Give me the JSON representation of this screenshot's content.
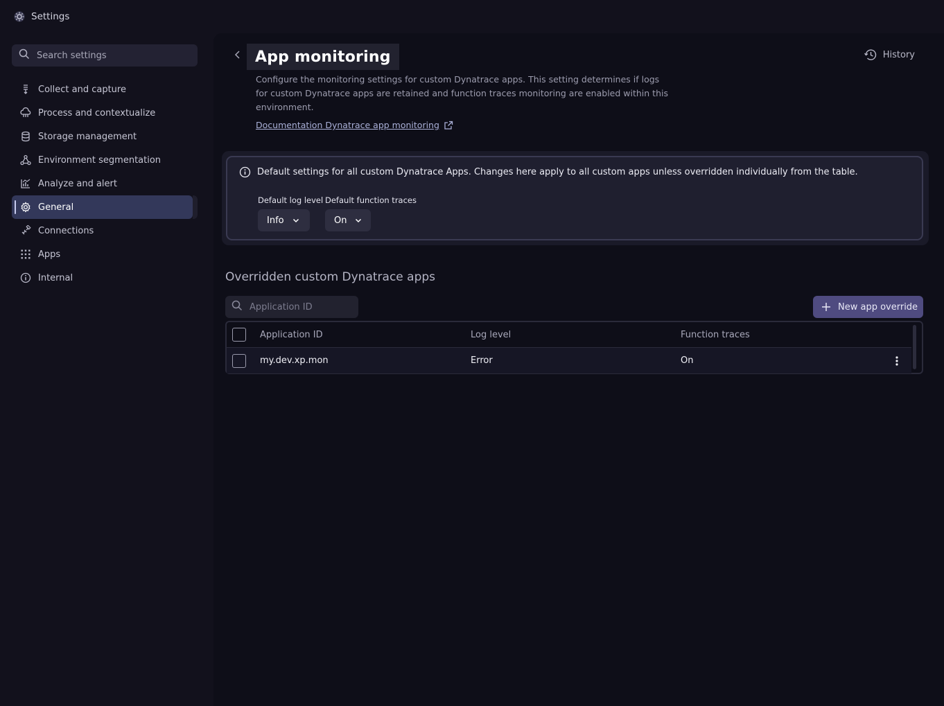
{
  "window": {
    "title": "Settings",
    "app_icon": "gear-icon"
  },
  "sidebar": {
    "search_placeholder": "Search settings",
    "items": [
      {
        "label": "Collect and capture",
        "icon": "collect-icon"
      },
      {
        "label": "Process and contextualize",
        "icon": "process-icon"
      },
      {
        "label": "Storage management",
        "icon": "database-icon"
      },
      {
        "label": "Environment segmentation",
        "icon": "segmentation-icon"
      },
      {
        "label": "Analyze and alert",
        "icon": "chart-icon"
      },
      {
        "label": "General",
        "icon": "gear-icon",
        "active": true
      },
      {
        "label": "Connections",
        "icon": "connections-icon"
      },
      {
        "label": "Apps",
        "icon": "apps-grid-icon"
      },
      {
        "label": "Internal",
        "icon": "info-icon"
      }
    ]
  },
  "header": {
    "title": "App monitoring",
    "history_label": "History",
    "description": "Configure the monitoring settings for custom Dynatrace apps. This setting determines if logs for custom Dynatrace apps are retained and function traces monitoring are enabled within this environment.",
    "doc_link": "Documentation Dynatrace app monitoring"
  },
  "defaults": {
    "info": "Default settings for all custom Dynatrace Apps. Changes here apply to all custom apps unless overridden individually from the table.",
    "log_level_label": "Default log level",
    "log_level_value": "Info",
    "function_traces_label": "Default function traces",
    "function_traces_value": "On"
  },
  "overrides": {
    "title": "Overridden custom Dynatrace apps",
    "search_placeholder": "Application ID",
    "new_button": "New app override",
    "columns": [
      "Application ID",
      "Log level",
      "Function traces"
    ],
    "rows": [
      {
        "app_id": "my.dev.xp.mon",
        "log_level": "Error",
        "function_traces": "On"
      }
    ]
  },
  "colors": {
    "accent_button": "#4f4b80",
    "active_nav": "#33385a",
    "background": "#12111c"
  }
}
